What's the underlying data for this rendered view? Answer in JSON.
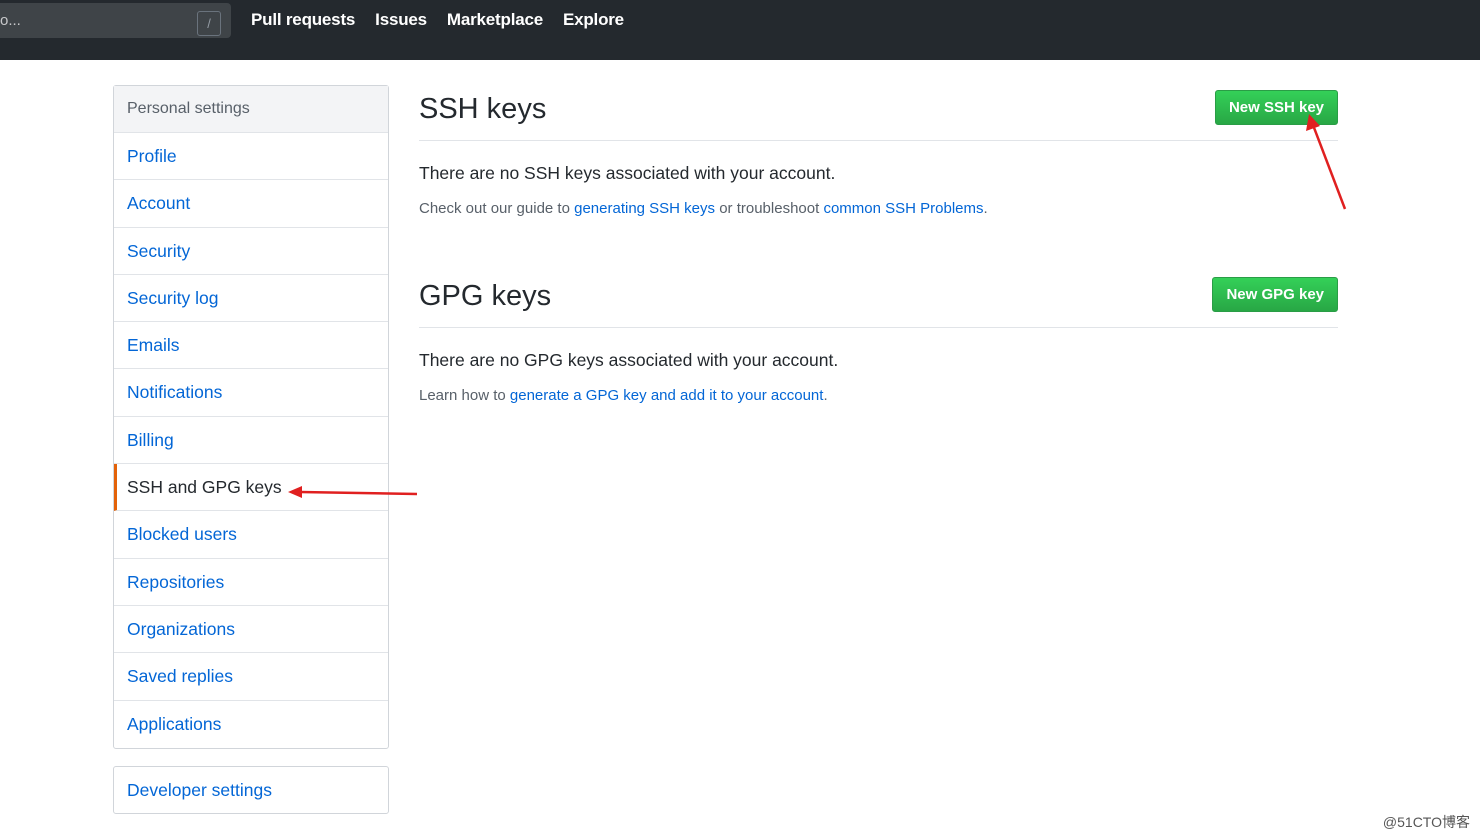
{
  "header": {
    "search_placeholder": "o...",
    "search_shortcut": "/",
    "nav": [
      {
        "label": "Pull requests"
      },
      {
        "label": "Issues"
      },
      {
        "label": "Marketplace"
      },
      {
        "label": "Explore"
      }
    ]
  },
  "sidebar": {
    "heading": "Personal settings",
    "items": [
      {
        "label": "Profile"
      },
      {
        "label": "Account"
      },
      {
        "label": "Security"
      },
      {
        "label": "Security log"
      },
      {
        "label": "Emails"
      },
      {
        "label": "Notifications"
      },
      {
        "label": "Billing"
      },
      {
        "label": "SSH and GPG keys",
        "active": true
      },
      {
        "label": "Blocked users"
      },
      {
        "label": "Repositories"
      },
      {
        "label": "Organizations"
      },
      {
        "label": "Saved replies"
      },
      {
        "label": "Applications"
      }
    ],
    "developer_settings": "Developer settings"
  },
  "ssh": {
    "title": "SSH keys",
    "button": "New SSH key",
    "empty": "There are no SSH keys associated with your account.",
    "note_prefix": "Check out our guide to ",
    "note_link1": "generating SSH keys",
    "note_mid": " or troubleshoot ",
    "note_link2": "common SSH Problems",
    "note_suffix": "."
  },
  "gpg": {
    "title": "GPG keys",
    "button": "New GPG key",
    "empty": "There are no GPG keys associated with your account.",
    "note_prefix": "Learn how to ",
    "note_link": "generate a GPG key and add it to your account",
    "note_suffix": "."
  },
  "watermark": "@51CTO博客",
  "colors": {
    "header_bg": "#24292e",
    "link": "#0366d6",
    "button_green": "#28a745",
    "active_border": "#e36209",
    "annotation_arrow": "#e02020"
  }
}
